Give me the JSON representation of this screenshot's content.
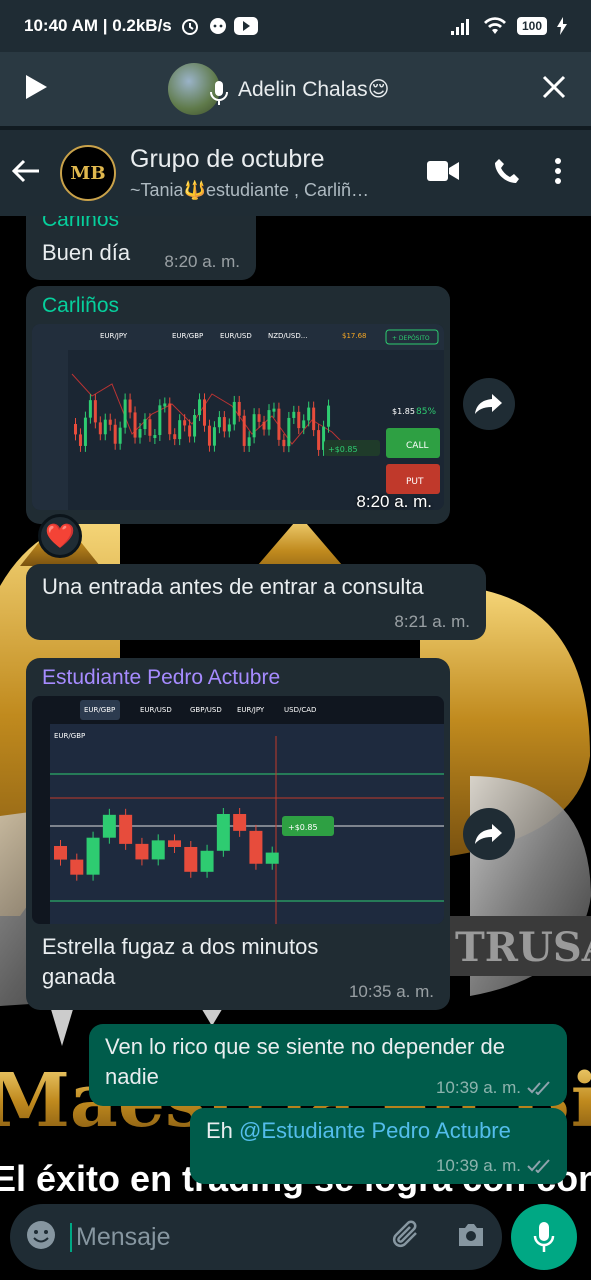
{
  "status": {
    "time": "10:40 AM",
    "speed": "0.2kB/s",
    "battery": "100"
  },
  "voice_chat": {
    "name": "Adelin Chalas😌"
  },
  "header": {
    "title": "Grupo de octubre",
    "subtitle": "~Tania🔱estudiante , Carliñ…",
    "avatar_text": "MB"
  },
  "messages": [
    {
      "sender": "Carliños",
      "text": "Buen día",
      "time": "8:20 a. m."
    },
    {
      "sender": "Carliños",
      "time": "8:20 a. m.",
      "reaction": "❤️",
      "image": {
        "tabs": [
          "EUR/JPY",
          "EUR/GBP",
          "EUR/USD",
          "NZD/USD..."
        ],
        "balance": "$17.68",
        "deposit_label": "+ DEPÓSITO",
        "payout": "85%",
        "amount": "$1.85",
        "call_label": "CALL",
        "put_label": "PUT",
        "profit": "+$0.85"
      }
    },
    {
      "text": "Una entrada antes de entrar a consulta",
      "time": "8:21 a. m."
    },
    {
      "sender": "Estudiante Pedro Actubre",
      "text": "Estrella fugaz a dos minutos ganada",
      "time": "10:35 a. m.",
      "image": {
        "tabs": [
          "EUR/GBP",
          "EUR/USD",
          "GBP/USD",
          "EUR/JPY",
          "USD/CAD"
        ],
        "profit": "+$0.85",
        "pair": "EUR/GBP"
      }
    },
    {
      "text": "Ven lo rico que se siente no depender de nadie",
      "time": "10:39 a. m.",
      "outgoing": true
    },
    {
      "prefix": "Eh ",
      "mention": "@Estudiante Pedro Actubre",
      "time": "10:39 a. m.",
      "outgoing": true
    }
  ],
  "wallpaper": {
    "line1": "Maestría en Binar",
    "line2": "El éxito en trading se logra con conocimie",
    "badge": "TRUSA"
  },
  "composer": {
    "placeholder": "Mensaje"
  },
  "colors": {
    "sender1": "#06cf9c",
    "sender2": "#a68bff",
    "mention": "#53bdeb",
    "accent": "#00a884"
  }
}
